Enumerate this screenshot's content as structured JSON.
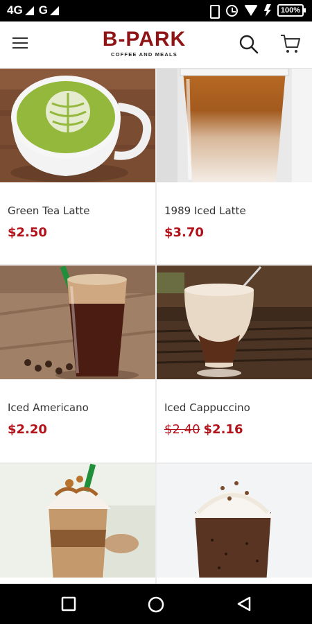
{
  "status_bar": {
    "network_1": "4G",
    "network_2": "G",
    "battery": "100%"
  },
  "app_bar": {
    "brand": "B-PARK",
    "tagline": "COFFEE AND MEALS"
  },
  "products": [
    {
      "name": "Green Tea Latte",
      "price": "$2.50"
    },
    {
      "name": "1989 Iced Latte",
      "price": "$3.70"
    },
    {
      "name": "Iced Americano",
      "price": "$2.20"
    },
    {
      "name": "Iced Cappuccino",
      "original_price": "$2.40",
      "price": "$2.16"
    },
    {
      "name": ""
    },
    {
      "name": ""
    }
  ],
  "colors": {
    "brand": "#8e1416",
    "price": "#b3111a"
  },
  "icons": [
    "menu-icon",
    "search-icon",
    "cart-icon",
    "recents-icon",
    "home-icon",
    "back-icon"
  ]
}
